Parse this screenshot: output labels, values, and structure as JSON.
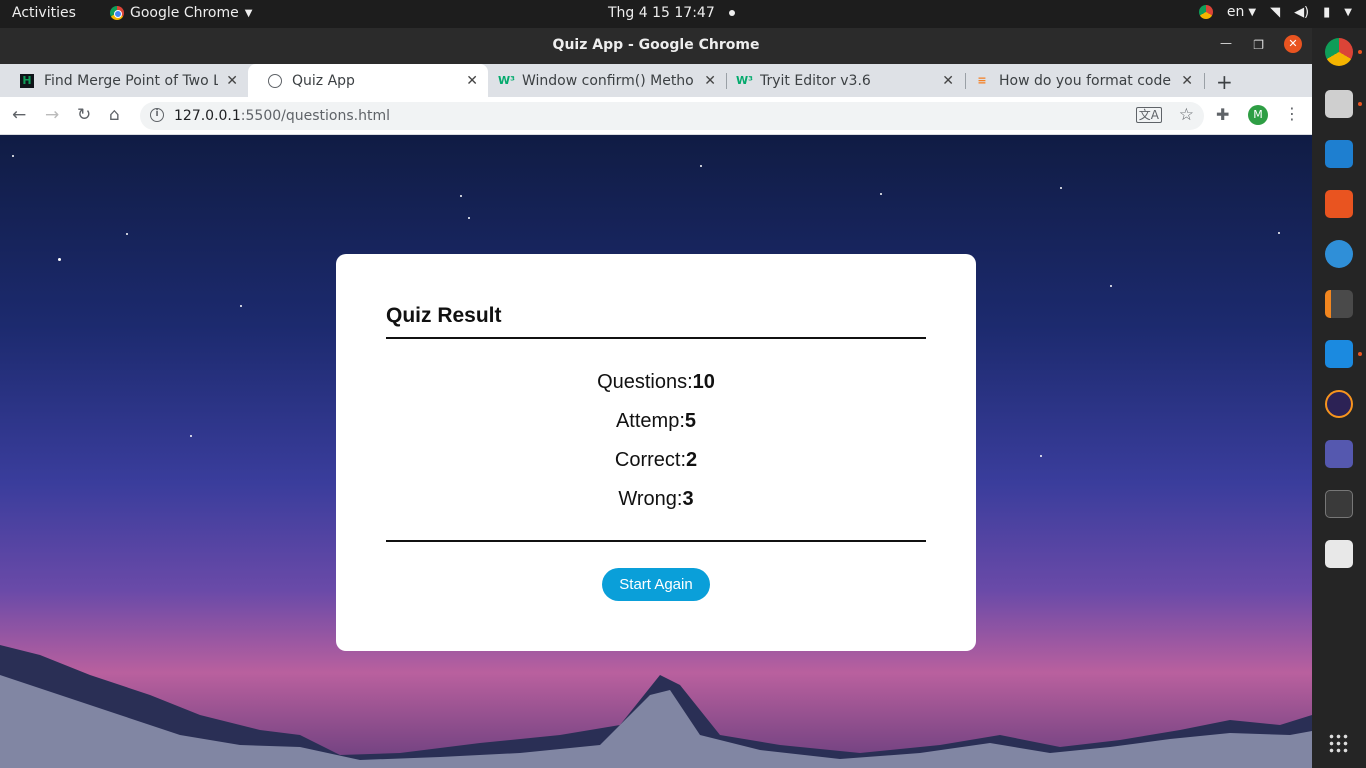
{
  "topbar": {
    "activities": "Activities",
    "app_name": "Google Chrome",
    "clock": "Thg 4 15  17:47",
    "lang": "en"
  },
  "window": {
    "title": "Quiz App - Google Chrome"
  },
  "tabs": [
    {
      "label": "Find Merge Point of Two L",
      "icon": "hackerrank-icon"
    },
    {
      "label": "Quiz App",
      "icon": "globe-icon"
    },
    {
      "label": "Window confirm() Metho",
      "icon": "w3schools-icon"
    },
    {
      "label": "Tryit Editor v3.6",
      "icon": "w3schools-icon"
    },
    {
      "label": "How do you format code i",
      "icon": "stackoverflow-icon"
    }
  ],
  "toolbar": {
    "url_host": "127.0.0.1",
    "url_rest": ":5500/questions.html",
    "avatar_letter": "M"
  },
  "quiz": {
    "title": "Quiz Result",
    "questions_label": "Questions:",
    "questions_value": "10",
    "attemp_label": "Attemp:",
    "attemp_value": "5",
    "correct_label": "Correct:",
    "correct_value": "2",
    "wrong_label": "Wrong:",
    "wrong_value": "3",
    "button": "Start Again"
  },
  "dock": {
    "apps": [
      "chrome-icon",
      "files-icon",
      "libreoffice-writer-icon",
      "app-store-icon",
      "help-icon",
      "sublime-text-icon",
      "vscode-icon",
      "eclipse-icon",
      "teams-icon",
      "terminal-icon",
      "document-viewer-icon"
    ]
  },
  "colors": {
    "accent_button": "#0a9fd9",
    "ubuntu_orange": "#e95420"
  }
}
